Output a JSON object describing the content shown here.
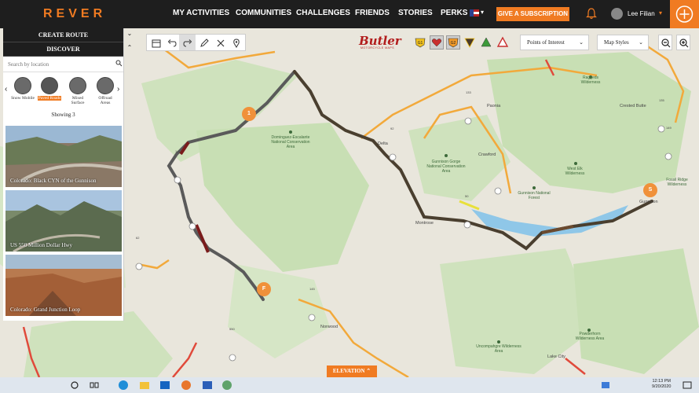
{
  "nav": {
    "logo": "REVER",
    "links": [
      "MY ACTIVITIES",
      "COMMUNITIES",
      "CHALLENGES",
      "FRIENDS",
      "STORIES",
      "PERKS"
    ],
    "subscribe_label": "GIVE A SUBSCRIPTION",
    "user_name": "Lee Filian",
    "accent_color": "#f07b22"
  },
  "sidebar": {
    "create_route": "CREATE ROUTE",
    "discover": "DISCOVER",
    "search_placeholder": "Search by location",
    "surfaces": [
      {
        "label": "Snow Mobile",
        "active": false
      },
      {
        "label": "Paved Roads",
        "active": true
      },
      {
        "label": "Mixed Surface",
        "active": false
      },
      {
        "label": "Offroad Areas",
        "active": false
      }
    ],
    "showing": "Showing 3",
    "routes": [
      {
        "title": "Colorado: Black CYN of the Gunnison"
      },
      {
        "title": "US 550 Million Dollar Hwy"
      },
      {
        "title": "Colorado: Grand Junction Loop"
      }
    ]
  },
  "map": {
    "brand_name": "Butler",
    "brand_sub": "MOTORCYCLE MAPS",
    "points_of_interest": "Points of Interest",
    "map_styles": "Map Styles",
    "elevation": "ELEVATION",
    "waypoint_labels": [
      "1",
      "S",
      "F"
    ],
    "towns": [
      "Delta",
      "Paonia",
      "Crawford",
      "Montrose",
      "Gunnison",
      "Crested Butte",
      "Norwood",
      "Lake City"
    ],
    "areas": [
      "Dominguez-Escalante National Conservation Area",
      "Gunnison Gorge National Conservation Area",
      "Gunnison National Forest",
      "West Elk Wilderness",
      "Raggeds Wilderness",
      "Uncompahgre Wilderness Area",
      "Powderhorn Wilderness Area",
      "Fossil Ridge Wilderness"
    ],
    "highway_numbers": [
      "133",
      "92",
      "50",
      "135",
      "141",
      "145",
      "62",
      "149",
      "550"
    ]
  },
  "taskbar": {
    "time": "12:13 PM",
    "date": "9/20/2020"
  }
}
